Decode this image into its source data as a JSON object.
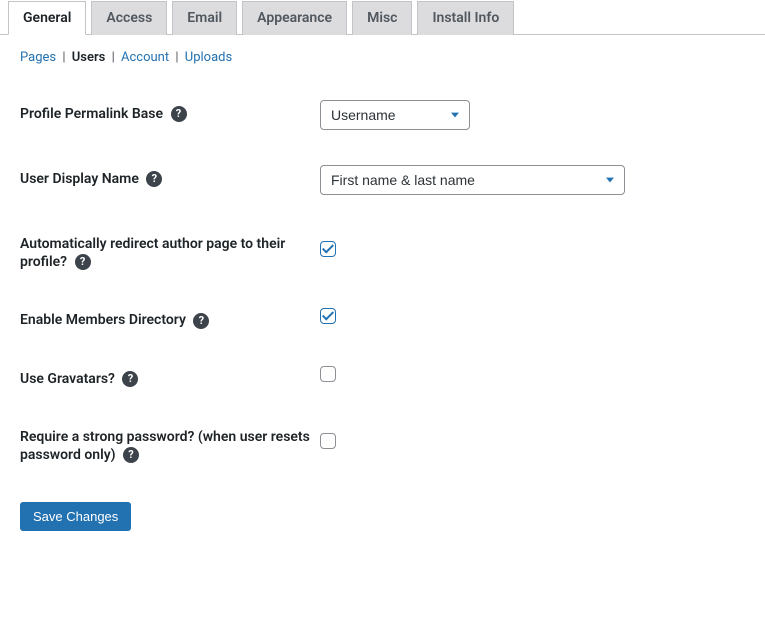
{
  "tabs": [
    {
      "label": "General",
      "active": true
    },
    {
      "label": "Access",
      "active": false
    },
    {
      "label": "Email",
      "active": false
    },
    {
      "label": "Appearance",
      "active": false
    },
    {
      "label": "Misc",
      "active": false
    },
    {
      "label": "Install Info",
      "active": false
    }
  ],
  "subnav": {
    "pages": "Pages",
    "users": "Users",
    "account": "Account",
    "uploads": "Uploads"
  },
  "fields": {
    "profile_permalink_base": {
      "label": "Profile Permalink Base",
      "value": "Username"
    },
    "user_display_name": {
      "label": "User Display Name",
      "value": "First name & last name"
    },
    "redirect_author": {
      "label": "Automatically redirect author page to their profile?",
      "checked": true
    },
    "members_directory": {
      "label": "Enable Members Directory",
      "checked": true
    },
    "gravatars": {
      "label": "Use Gravatars?",
      "checked": false
    },
    "strong_password": {
      "label": "Require a strong password? (when user resets password only)",
      "checked": false
    }
  },
  "submit_label": "Save Changes"
}
